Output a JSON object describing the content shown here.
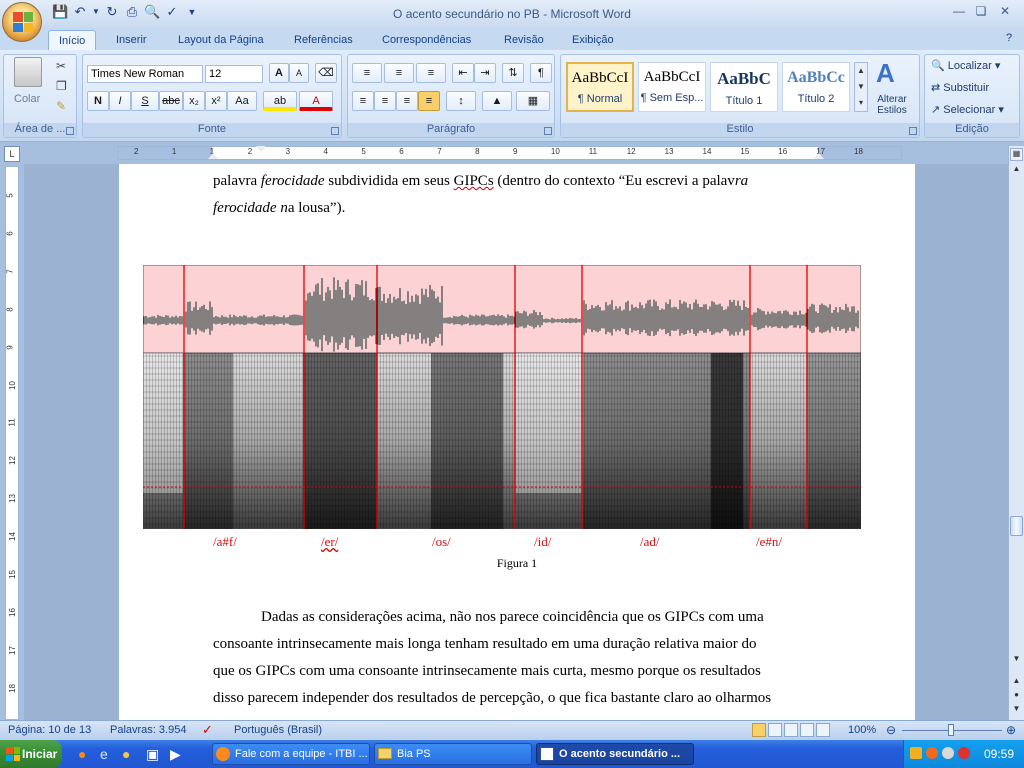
{
  "window": {
    "title": "O acento secundário no PB - Microsoft Word"
  },
  "tabs": [
    "Início",
    "Inserir",
    "Layout da Página",
    "Referências",
    "Correspondências",
    "Revisão",
    "Exibição"
  ],
  "ribbon": {
    "clipboard": {
      "label": "Área de ...",
      "paste": "Colar"
    },
    "font": {
      "label": "Fonte",
      "family": "Times New Roman",
      "size": "12"
    },
    "paragraph": {
      "label": "Parágrafo"
    },
    "styles": {
      "label": "Estilo",
      "items": [
        {
          "sample": "AaBbCcI",
          "name": "¶ Normal"
        },
        {
          "sample": "AaBbCcI",
          "name": "¶ Sem Esp..."
        },
        {
          "sample": "AaBbC",
          "name": "Título 1"
        },
        {
          "sample": "AaBbCc",
          "name": "Título 2"
        }
      ],
      "change": "Alterar Estilos"
    },
    "editing": {
      "label": "Edição",
      "find": "Localizar",
      "replace": "Substituir",
      "select": "Selecionar"
    }
  },
  "ruler": {
    "h_ticks": [
      "2",
      "1",
      "1",
      "2",
      "3",
      "4",
      "5",
      "6",
      "7",
      "8",
      "9",
      "10",
      "11",
      "12",
      "13",
      "14",
      "15",
      "16",
      "17",
      "18"
    ],
    "v_ticks": [
      "5",
      "6",
      "7",
      "8",
      "9",
      "10",
      "11",
      "12",
      "13",
      "14",
      "15",
      "16",
      "17",
      "18"
    ]
  },
  "document": {
    "top_line1_a": "palavra ",
    "top_line1_b": "ferocidade",
    "top_line1_c": " subdividida em seus ",
    "top_line1_d": "GIPCs",
    "top_line1_e": " (dentro do contexto “Eu escrevi a palav",
    "top_line1_f": "ra",
    "top_line2_a": "ferocidade",
    "top_line2_b": " n",
    "top_line2_c": "a lousa”).",
    "segments": [
      "/a#f/",
      "/er/",
      "/os/",
      "/id/",
      "/ad/",
      "/e#n/"
    ],
    "caption": "Figura 1",
    "para1": "Dadas as considerações acima, não nos parece coincidência que os GIPCs com uma",
    "para2": "consoante intrinsecamente mais longa tenham resultado em uma duração relativa maior do",
    "para3": "que os GIPCs com uma consoante intrinsecamente mais curta, mesmo porque os resultados",
    "para4": "disso parecem independer dos resultados de percepção, o que fica bastante claro ao olharmos"
  },
  "status": {
    "page": "Página: 10 de 13",
    "words": "Palavras: 3.954",
    "language": "Português (Brasil)",
    "zoom": "100%"
  },
  "taskbar": {
    "start": "Iniciar",
    "tasks": [
      "Fale com a equipe - ITBI ...",
      "Bia PS",
      "O acento secundário ..."
    ],
    "clock": "09:59"
  },
  "colors": {
    "waveform_bg": "#fcd2d4",
    "boundary": "#e00000",
    "segment_text": "#d01010"
  }
}
